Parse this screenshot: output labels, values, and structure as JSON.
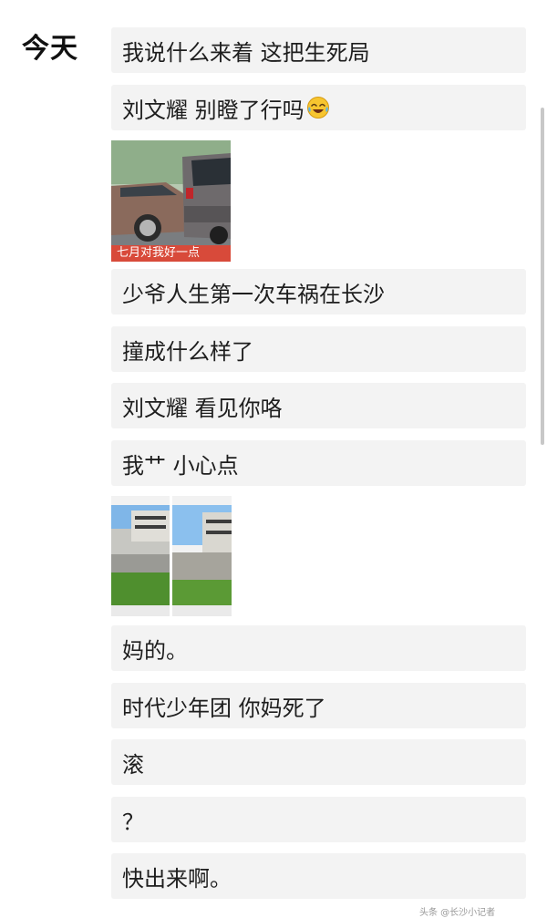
{
  "day_label": "今天",
  "messages": [
    {
      "text": "我说什么来着 这把生死局"
    },
    {
      "text": "刘文耀 别瞪了行吗",
      "emoji": "laughing-crying-emoji"
    },
    {
      "type": "image",
      "caption": "七月对我好一点"
    },
    {
      "text": "少爷人生第一次车祸在长沙"
    },
    {
      "text": "撞成什么样了"
    },
    {
      "text": "刘文耀 看见你咯"
    },
    {
      "text": "我艹 小心点"
    },
    {
      "type": "image"
    },
    {
      "text": "妈的。"
    },
    {
      "text": "时代少年团 你妈死了"
    },
    {
      "text": "滚"
    },
    {
      "text": "？"
    },
    {
      "text": "快出来啊。"
    }
  ],
  "watermark": "头条 @长沙小记者"
}
